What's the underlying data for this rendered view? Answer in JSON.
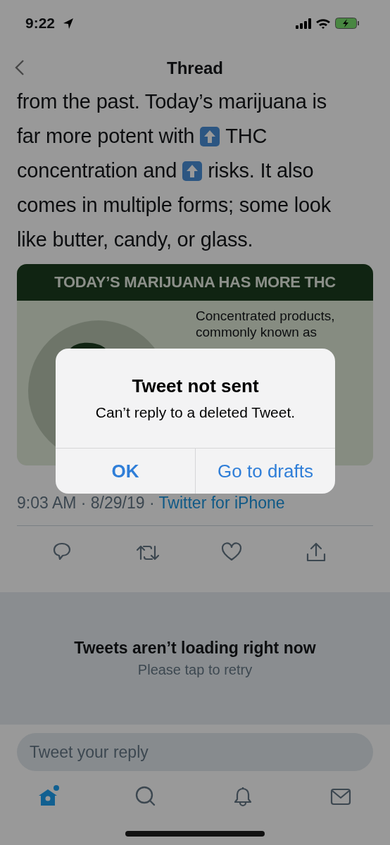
{
  "status_bar": {
    "time": "9:22"
  },
  "nav": {
    "title": "Thread"
  },
  "tweet": {
    "lines": [
      [
        {
          "kind": "text",
          "text": "from the past. Today’s marijuana is"
        }
      ],
      [
        {
          "kind": "text",
          "text": "far more potent with"
        },
        {
          "kind": "emoji"
        },
        {
          "kind": "text",
          "text": "THC"
        }
      ],
      [
        {
          "kind": "text",
          "text": "concentration and"
        },
        {
          "kind": "emoji"
        },
        {
          "kind": "text",
          "text": "risks. It also"
        }
      ],
      [
        {
          "kind": "text",
          "text": "comes in multiple forms; some look"
        }
      ],
      [
        {
          "kind": "text",
          "text": "like butter, candy, or glass."
        }
      ]
    ],
    "image": {
      "heading": "TODAY’S MARIJUANA HAS MORE THC",
      "lines": [
        "Concentrated products,",
        "commonly known as"
      ]
    },
    "meta": {
      "timestamp": "9:03 AM · 8/29/19 · ",
      "source": "Twitter for iPhone"
    },
    "actions": [
      {
        "kind": "reply"
      },
      {
        "kind": "retweet"
      },
      {
        "kind": "like"
      },
      {
        "kind": "share"
      }
    ]
  },
  "error": {
    "title": "Tweets aren’t loading right now",
    "hint": "Please tap to retry"
  },
  "reply_field": {
    "placeholder": "Tweet your reply"
  },
  "tab_bar": [
    {
      "kind": "home",
      "selected": true
    },
    {
      "kind": "search",
      "selected": false
    },
    {
      "kind": "notifications",
      "selected": false
    },
    {
      "kind": "messages",
      "selected": false
    }
  ],
  "alert": {
    "title": "Tweet not sent",
    "message": "Can’t reply to a deleted Tweet.",
    "buttons": [
      {
        "label": "OK",
        "kind": "default"
      },
      {
        "label": "Go to drafts",
        "kind": "normal"
      }
    ]
  }
}
